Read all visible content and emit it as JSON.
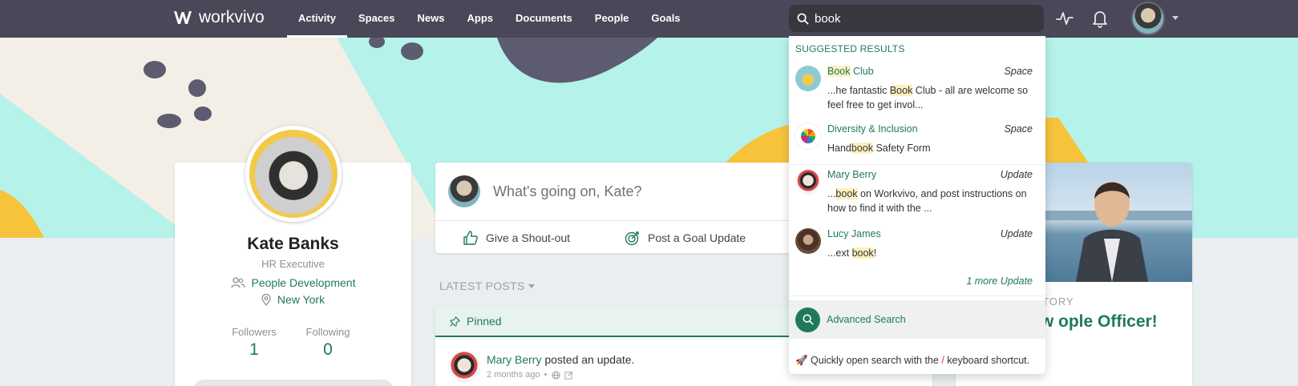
{
  "app": {
    "logo_text": "workvivo"
  },
  "nav": {
    "items": [
      {
        "label": "Activity",
        "active": true
      },
      {
        "label": "Spaces"
      },
      {
        "label": "News"
      },
      {
        "label": "Apps"
      },
      {
        "label": "Documents"
      },
      {
        "label": "People"
      },
      {
        "label": "Goals"
      }
    ]
  },
  "search": {
    "value": "book",
    "icon": "search-icon"
  },
  "top_icons": [
    "activity-pulse-icon",
    "bell-icon",
    "user-avatar",
    "chevron-down-icon"
  ],
  "search_dropdown": {
    "heading": "SUGGESTED RESULTS",
    "results": [
      {
        "title_hl": "Book",
        "title_rest": " Club",
        "type": "Space",
        "snippet_parts": [
          "...he fantastic ",
          "Book",
          " Club - all are welcome so feel free to get invol..."
        ]
      },
      {
        "title_hl": "",
        "title_rest": "Diversity & Inclusion",
        "type": "Space",
        "snippet_parts": [
          "Hand",
          "book",
          " Safety Form"
        ]
      },
      {
        "title_hl": "",
        "title_rest": "Mary Berry",
        "type": "Update",
        "snippet_parts": [
          "...",
          "book",
          " on Workvivo, and post instructions on how to find it with the ..."
        ]
      },
      {
        "title_hl": "",
        "title_rest": "Lucy James",
        "type": "Update",
        "snippet_parts": [
          "...ext ",
          "book",
          "!"
        ]
      }
    ],
    "more_link": "1 more Update",
    "advanced_search": "Advanced Search",
    "shortcut_prefix": "🚀 Quickly open search with the ",
    "shortcut_key": "/",
    "shortcut_suffix": " keyboard shortcut."
  },
  "profile": {
    "name": "Kate Banks",
    "title": "HR Executive",
    "department": "People Development",
    "location": "New York",
    "followers_label": "Followers",
    "followers_value": "1",
    "following_label": "Following",
    "following_value": "0"
  },
  "composer": {
    "placeholder": "What's going on, Kate?",
    "shoutout_label": "Give a Shout-out",
    "goal_label": "Post a Goal Update"
  },
  "feed": {
    "latest_posts_label": "LATEST POSTS",
    "pinned_label": "Pinned",
    "post": {
      "author": "Mary Berry",
      "action": " posted an update.",
      "time": "2 months ago",
      "separator": "•"
    }
  },
  "story": {
    "kicker": "TORY",
    "title": "to our new ople Officer!"
  },
  "colors": {
    "brand_green": "#1f7a5c",
    "topbar": "#4a4858",
    "banner_teal": "#b5f2ea",
    "highlight": "#fdf0bf"
  }
}
